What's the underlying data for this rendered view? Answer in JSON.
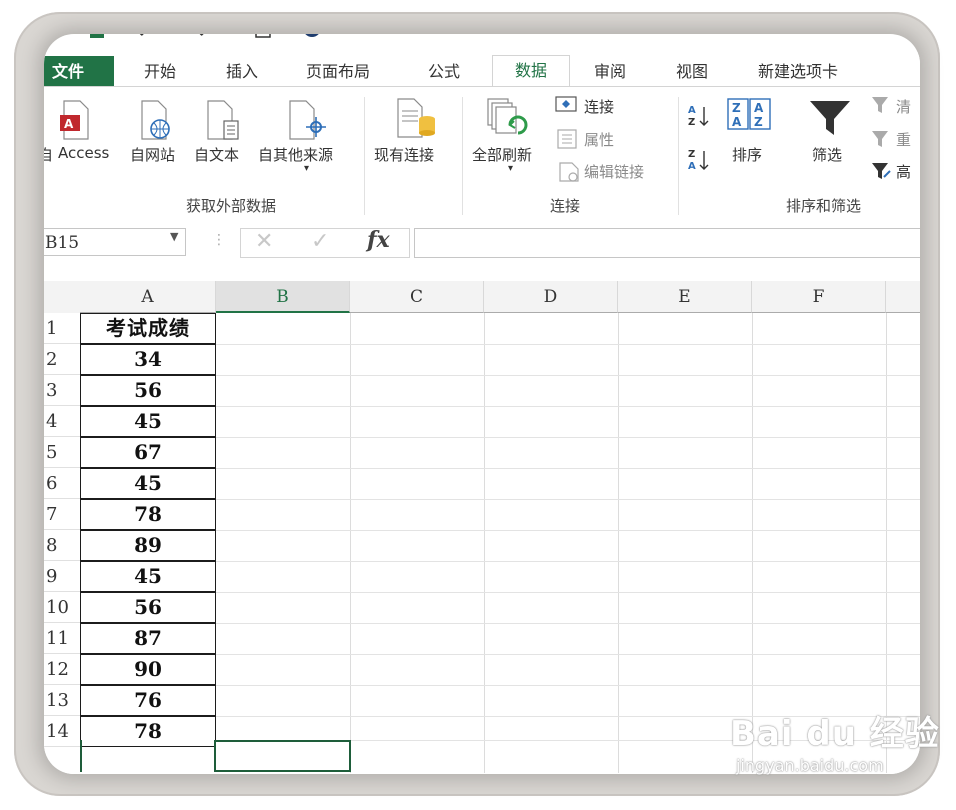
{
  "ribbon_tabs": {
    "file": "文件",
    "home": "开始",
    "insert": "插入",
    "page_layout": "页面布局",
    "formulas": "公式",
    "data": "数据",
    "review": "审阅",
    "view": "视图",
    "new_tab": "新建选项卡"
  },
  "ribbon": {
    "get_external": {
      "access": "Access",
      "web": "自网站",
      "text": "自文本",
      "other": "自其他来源",
      "existing": "现有连接",
      "group_label": "获取外部数据",
      "prefix_char": "自"
    },
    "connections": {
      "refresh_all": "全部刷新",
      "connections": "连接",
      "properties": "属性",
      "edit_links": "编辑链接",
      "group_label": "连接"
    },
    "sort_filter": {
      "sort": "排序",
      "filter": "筛选",
      "clear": "清",
      "reapply": "重",
      "advanced": "高",
      "group_label": "排序和筛选"
    }
  },
  "formula_bar": {
    "name_box": "B15",
    "cancel_symbol": "✕",
    "enter_symbol": "✓",
    "fx_label": "fx",
    "content": ""
  },
  "columns": [
    "A",
    "B",
    "C",
    "D",
    "E",
    "F"
  ],
  "rows": [
    "1",
    "2",
    "3",
    "4",
    "5",
    "6",
    "7",
    "8",
    "9",
    "10",
    "11",
    "12",
    "13",
    "14"
  ],
  "column_a": {
    "header": "考试成绩",
    "values": [
      "34",
      "56",
      "45",
      "67",
      "45",
      "78",
      "89",
      "45",
      "56",
      "87",
      "90",
      "76",
      "78"
    ]
  },
  "watermark": {
    "main": "Bai du 经验",
    "sub": "jingyan.baidu.com"
  },
  "colors": {
    "accent": "#217346",
    "selection": "#1e5d3a"
  }
}
